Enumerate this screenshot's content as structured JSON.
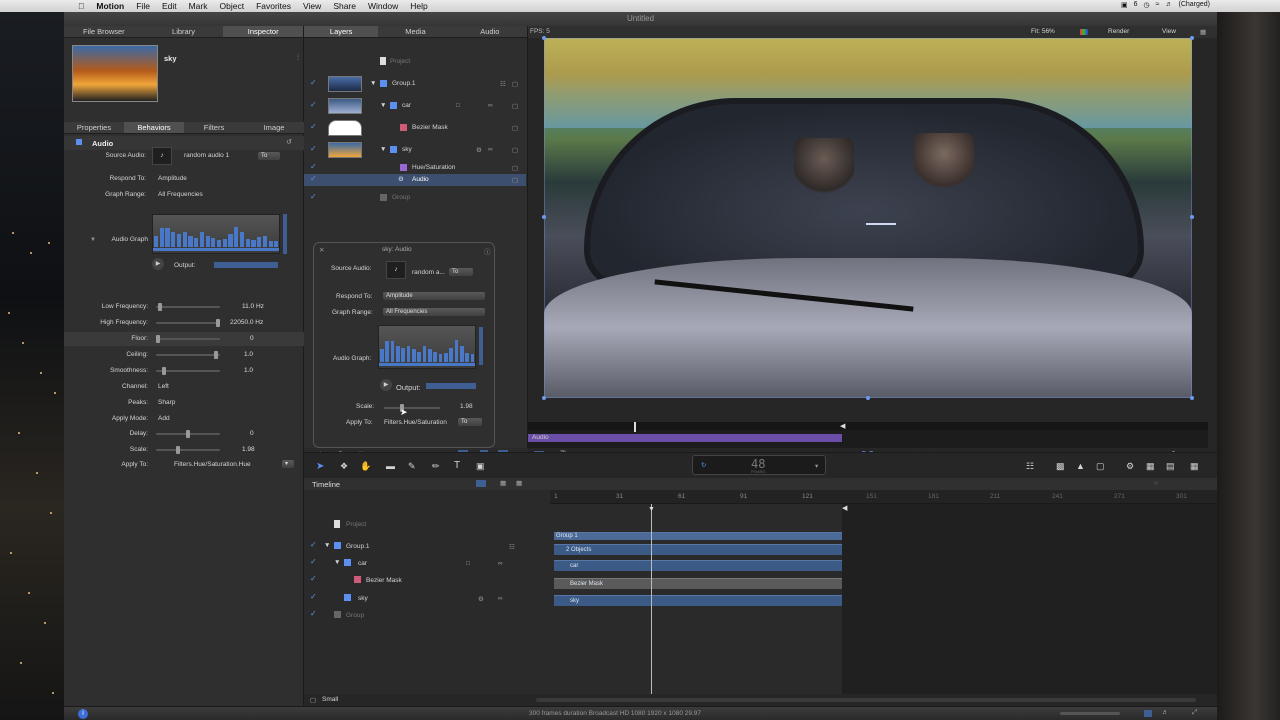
{
  "menubar": {
    "app": "Motion",
    "items": [
      "File",
      "Edit",
      "Mark",
      "Object",
      "Favorites",
      "View",
      "Share",
      "Window",
      "Help"
    ],
    "status": [
      "6",
      "(Charged)"
    ]
  },
  "window": {
    "title": "Untitled"
  },
  "left_tabs": [
    "File Browser",
    "Library",
    "Inspector"
  ],
  "preview": {
    "name": "sky"
  },
  "inspector_tabs": [
    "Properties",
    "Behaviors",
    "Filters",
    "Image"
  ],
  "behavior": {
    "title": "Audio",
    "source_audio_label": "Source Audio:",
    "source_audio_value": "random audio 1",
    "source_to": "To",
    "respond_to_label": "Respond To:",
    "respond_to_value": "Amplitude",
    "graph_range_label": "Graph Range:",
    "graph_range_value": "All Frequencies",
    "audio_graph_label": "Audio Graph",
    "output_label": "Output:",
    "params": [
      {
        "label": "Low Frequency:",
        "value": "11.0 Hz",
        "knob": 0.1
      },
      {
        "label": "High Frequency:",
        "value": "22050.0 Hz",
        "knob": 0.9
      },
      {
        "label": "Floor:",
        "value": "0",
        "knob": 0.0
      },
      {
        "label": "Ceiling:",
        "value": "1.0",
        "knob": 0.9
      },
      {
        "label": "Smoothness:",
        "value": "1.0",
        "knob": 0.1
      }
    ],
    "channel_label": "Channel:",
    "channel_value": "Left",
    "peaks_label": "Peaks:",
    "peaks_value": "Sharp",
    "apply_mode_label": "Apply Mode:",
    "apply_mode_value": "Add",
    "delay_label": "Delay:",
    "delay_value": "0",
    "scale_label": "Scale:",
    "scale_value": "1.98",
    "apply_to_label": "Apply To:",
    "apply_to_value": "Filters.Hue/Saturation.Hue"
  },
  "graph_bars": [
    0.55,
    0.9,
    0.9,
    0.7,
    0.6,
    0.7,
    0.55,
    0.45,
    0.7,
    0.55,
    0.45,
    0.35,
    0.4,
    0.6,
    0.95,
    0.7,
    0.4,
    0.35,
    0.5,
    0.55,
    0.3,
    0.3
  ],
  "layers_tabs": [
    "Layers",
    "Media",
    "Audio"
  ],
  "layers": [
    {
      "name": "Project"
    },
    {
      "name": "Group.1"
    },
    {
      "name": "car"
    },
    {
      "name": "Bezier Mask"
    },
    {
      "name": "sky"
    },
    {
      "name": "Hue/Saturation"
    },
    {
      "name": "Audio"
    },
    {
      "name": "Group"
    }
  ],
  "hud": {
    "title": "sky: Audio",
    "source_audio_label": "Source Audio:",
    "source_audio_value": "random a...",
    "source_to": "To",
    "respond_to_label": "Respond To:",
    "respond_to_value": "Amplitude",
    "graph_range_label": "Graph Range:",
    "graph_range_value": "All Frequencies",
    "audio_graph_label": "Audio Graph:",
    "output_label": "Output:",
    "scale_label": "Scale:",
    "scale_value": "1.98",
    "apply_to_label": "Apply To:",
    "apply_to_value": "Filters.Hue/Saturation",
    "apply_to_to": "To"
  },
  "canvas": {
    "fps": "FPS: 5",
    "fit": "Fit: 56%",
    "render": "Render",
    "view": "View"
  },
  "mini_timeline": {
    "label": "Audio"
  },
  "frame_display": {
    "value": "48",
    "unit": "FRAMES"
  },
  "timeline": {
    "title": "Timeline",
    "ruler": [
      "1",
      "31",
      "61",
      "91",
      "121",
      "151",
      "181",
      "211",
      "241",
      "271",
      "301"
    ],
    "rows": [
      {
        "name": "Project"
      },
      {
        "name": "Group.1"
      },
      {
        "name": "car"
      },
      {
        "name": "Bezier Mask"
      },
      {
        "name": "sky"
      },
      {
        "name": "Group"
      }
    ],
    "bars": [
      {
        "label": "Group 1"
      },
      {
        "label": "2 Objects"
      },
      {
        "label": "car"
      },
      {
        "label": "Bezier Mask"
      },
      {
        "label": "sky"
      }
    ],
    "size_label": "Small"
  },
  "status_bar": {
    "text": "300 frames duration Broadcast HD 1080 1920 x 1080 29.97"
  },
  "colors": {
    "accent": "#5b8ff0",
    "bar": "#3b5a86",
    "bg": "#2b2b2b"
  }
}
